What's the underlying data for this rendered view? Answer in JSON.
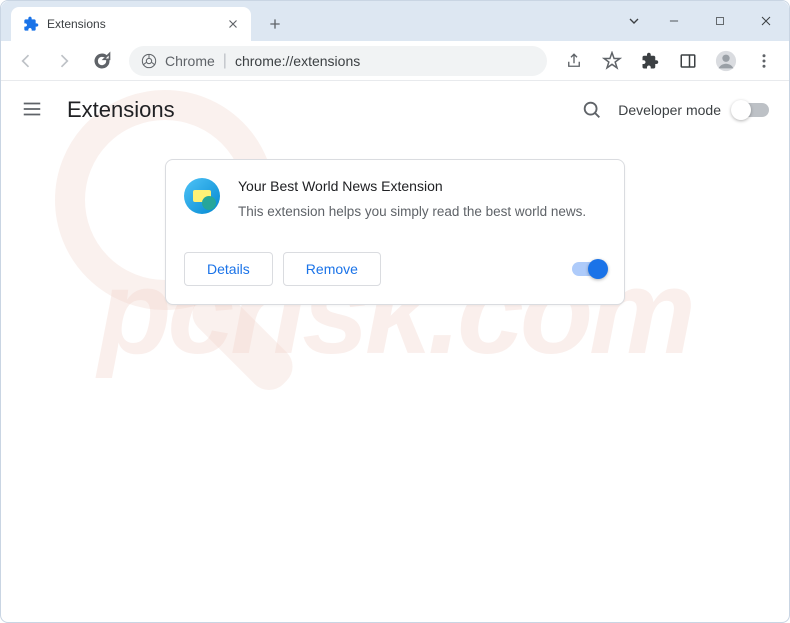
{
  "window": {
    "tab_title": "Extensions"
  },
  "omnibox": {
    "prefix": "Chrome",
    "url": "chrome://extensions"
  },
  "header": {
    "title": "Extensions",
    "dev_mode_label": "Developer mode",
    "dev_mode_on": false
  },
  "extension": {
    "name": "Your Best World News Extension",
    "description": "This extension helps you simply read the best world news.",
    "enabled": true,
    "details_label": "Details",
    "remove_label": "Remove"
  }
}
